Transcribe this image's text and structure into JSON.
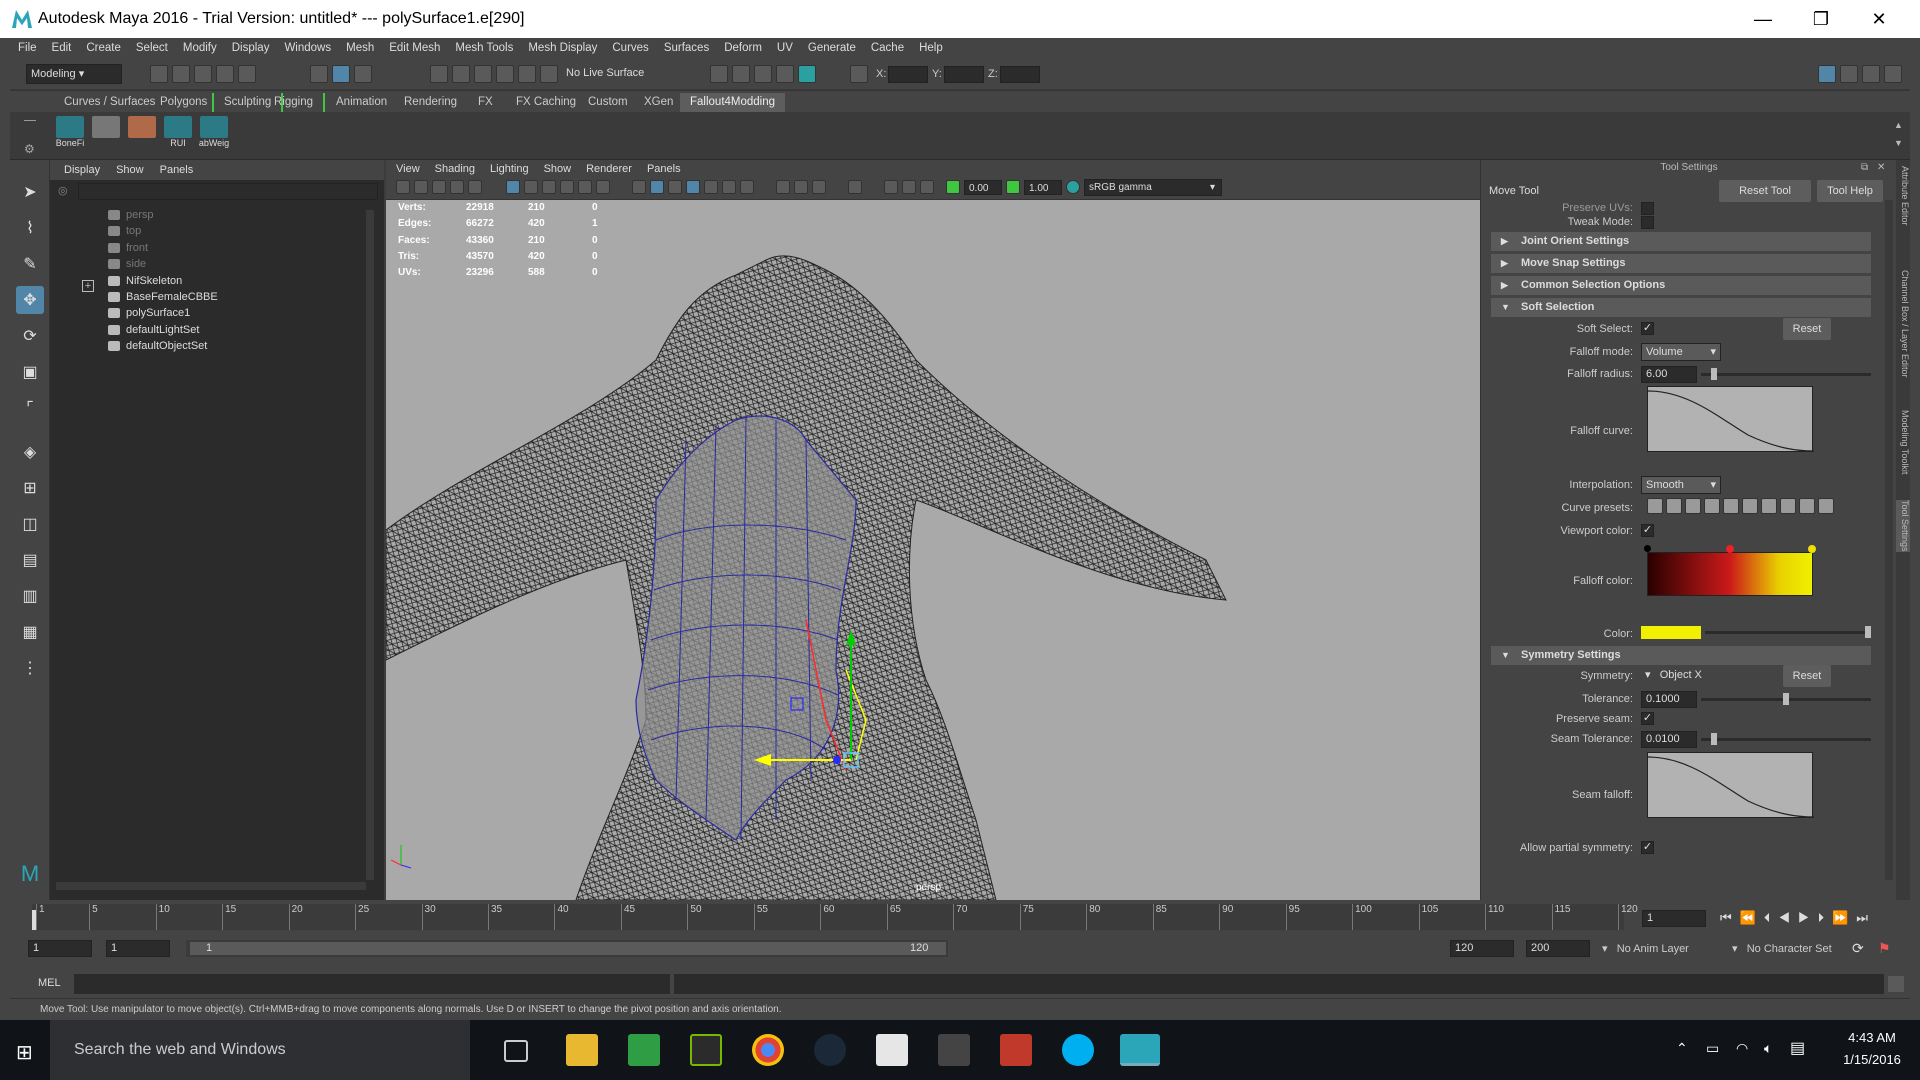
{
  "window": {
    "title": "Autodesk Maya 2016 - Trial Version: untitled*   ---   polySurface1.e[290]"
  },
  "menubar": [
    "File",
    "Edit",
    "Create",
    "Select",
    "Modify",
    "Display",
    "Windows",
    "Mesh",
    "Edit Mesh",
    "Mesh Tools",
    "Mesh Display",
    "Curves",
    "Surfaces",
    "Deform",
    "UV",
    "Generate",
    "Cache",
    "Help"
  ],
  "statusline": {
    "mode": "Modeling",
    "live_surface": "No Live Surface",
    "x_label": "X:",
    "y_label": "Y:",
    "z_label": "Z:"
  },
  "shelf_tabs": [
    "Curves / Surfaces",
    "Polygons",
    "Sculpting",
    "Rigging",
    "Animation",
    "Rendering",
    "FX",
    "FX Caching",
    "Custom",
    "XGen",
    "Fallout4Modding"
  ],
  "shelf_active": "Fallout4Modding",
  "shelf_icons": [
    "BoneFi",
    "",
    "",
    "RUI",
    "abWeig"
  ],
  "outliner": {
    "menu": [
      "Display",
      "Show",
      "Panels"
    ],
    "items": [
      {
        "label": "persp",
        "dim": true
      },
      {
        "label": "top",
        "dim": true
      },
      {
        "label": "front",
        "dim": true
      },
      {
        "label": "side",
        "dim": true
      },
      {
        "label": "NifSkeleton",
        "dim": false
      },
      {
        "label": "BaseFemaleCBBE",
        "dim": false
      },
      {
        "label": "polySurface1",
        "dim": false
      },
      {
        "label": "defaultLightSet",
        "dim": false
      },
      {
        "label": "defaultObjectSet",
        "dim": false
      }
    ]
  },
  "viewport": {
    "menu": [
      "View",
      "Shading",
      "Lighting",
      "Show",
      "Renderer",
      "Panels"
    ],
    "exposure": "0.00",
    "gamma": "1.00",
    "color_space": "sRGB gamma",
    "camera_label": "persp",
    "hud": [
      {
        "label": "Verts:",
        "a": "22918",
        "b": "210",
        "c": "0"
      },
      {
        "label": "Edges:",
        "a": "66272",
        "b": "420",
        "c": "1"
      },
      {
        "label": "Faces:",
        "a": "43360",
        "b": "210",
        "c": "0"
      },
      {
        "label": "Tris:",
        "a": "43570",
        "b": "420",
        "c": "0"
      },
      {
        "label": "UVs:",
        "a": "23296",
        "b": "588",
        "c": "0"
      }
    ]
  },
  "attr": {
    "header": "Tool Settings",
    "tool_name": "Move Tool",
    "reset_tool": "Reset Tool",
    "tool_help": "Tool Help",
    "preserve_uvs": "Preserve UVs:",
    "tweak_mode": "Tweak Mode:",
    "sections": {
      "joint": "Joint Orient Settings",
      "snap": "Move Snap Settings",
      "common": "Common Selection Options",
      "soft": "Soft Selection",
      "sym": "Symmetry Settings"
    },
    "soft_select_label": "Soft Select:",
    "reset": "Reset",
    "falloff_mode_label": "Falloff mode:",
    "falloff_mode": "Volume",
    "falloff_radius_label": "Falloff radius:",
    "falloff_radius": "6.00",
    "falloff_curve_label": "Falloff curve:",
    "interp_label": "Interpolation:",
    "interp": "Smooth",
    "presets_label": "Curve presets:",
    "viewport_color_label": "Viewport color:",
    "falloff_color_label": "Falloff color:",
    "color_label": "Color:",
    "symmetry_label": "Symmetry:",
    "symmetry": "Object X",
    "tolerance_label": "Tolerance:",
    "tolerance": "0.1000",
    "preserve_seam_label": "Preserve seam:",
    "seam_tol_label": "Seam Tolerance:",
    "seam_tol": "0.0100",
    "seam_falloff_label": "Seam falloff:",
    "partial_sym_label": "Allow partial symmetry:",
    "side_tabs": [
      "Attribute Editor",
      "Channel Box / Layer Editor",
      "Modeling Toolkit",
      "Tool Settings"
    ]
  },
  "timeline": {
    "ticks": [
      "1",
      "5",
      "10",
      "15",
      "20",
      "25",
      "30",
      "35",
      "40",
      "45",
      "50",
      "55",
      "60",
      "65",
      "70",
      "75",
      "80",
      "85",
      "90",
      "95",
      "100",
      "105",
      "110",
      "115",
      "120"
    ],
    "current_frame": "1",
    "range_start": "1",
    "range_start2": "1",
    "range_slider_start": "1",
    "range_slider_end": "120",
    "range_end": "120",
    "anim_end": "200",
    "anim_layer": "No Anim Layer",
    "character_set": "No Character Set"
  },
  "cmdline": {
    "label": "MEL"
  },
  "helpline": "Move Tool: Use manipulator to move object(s). Ctrl+MMB+drag to move components along normals. Use D or INSERT to change the pivot position and axis orientation.",
  "taskbar": {
    "search": "Search the web and Windows",
    "time": "4:43 AM",
    "date": "1/15/2016"
  },
  "colors": {
    "accent": "#5286a8",
    "shelf_active": "#5d5d5d",
    "sculpt_green": "#3fc83f"
  }
}
